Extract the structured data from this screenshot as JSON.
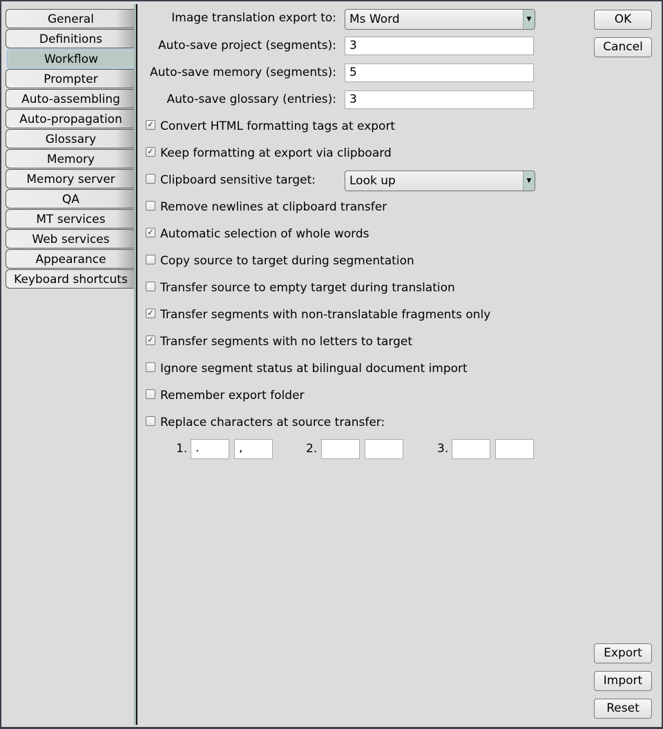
{
  "tabs": [
    "General",
    "Definitions",
    "Workflow",
    "Prompter",
    "Auto-assembling",
    "Auto-propagation",
    "Glossary",
    "Memory",
    "Memory server",
    "QA",
    "MT services",
    "Web services",
    "Appearance",
    "Keyboard shortcuts"
  ],
  "active_tab": "Workflow",
  "fields": {
    "image_export": {
      "label": "Image translation export to:",
      "value": "Ms Word"
    },
    "autosave_project": {
      "label": "Auto-save project (segments):",
      "value": "3"
    },
    "autosave_memory": {
      "label": "Auto-save memory (segments):",
      "value": "5"
    },
    "autosave_glossary": {
      "label": "Auto-save glossary (entries):",
      "value": "3"
    },
    "clipboard_target_value": "Look up"
  },
  "checkboxes": [
    {
      "label": "Convert HTML formatting tags at export",
      "checked": true
    },
    {
      "label": "Keep formatting at export via clipboard",
      "checked": true
    },
    {
      "label": "Clipboard sensitive target:",
      "checked": false
    },
    {
      "label": "Remove newlines at clipboard transfer",
      "checked": false
    },
    {
      "label": "Automatic selection of whole words",
      "checked": true
    },
    {
      "label": "Copy source to target during segmentation",
      "checked": false
    },
    {
      "label": "Transfer source to empty target during translation",
      "checked": false
    },
    {
      "label": "Transfer segments with non-translatable fragments only",
      "checked": true
    },
    {
      "label": "Transfer segments with no letters to target",
      "checked": true
    },
    {
      "label": "Ignore segment status at bilingual document import",
      "checked": false
    },
    {
      "label": "Remember export folder",
      "checked": false
    },
    {
      "label": "Replace characters at source transfer:",
      "checked": false
    }
  ],
  "replace": [
    {
      "num": "1.",
      "from": ".",
      "to": ","
    },
    {
      "num": "2.",
      "from": "",
      "to": ""
    },
    {
      "num": "3.",
      "from": "",
      "to": ""
    }
  ],
  "buttons": {
    "ok": "OK",
    "cancel": "Cancel",
    "export": "Export",
    "import": "Import",
    "reset": "Reset"
  }
}
